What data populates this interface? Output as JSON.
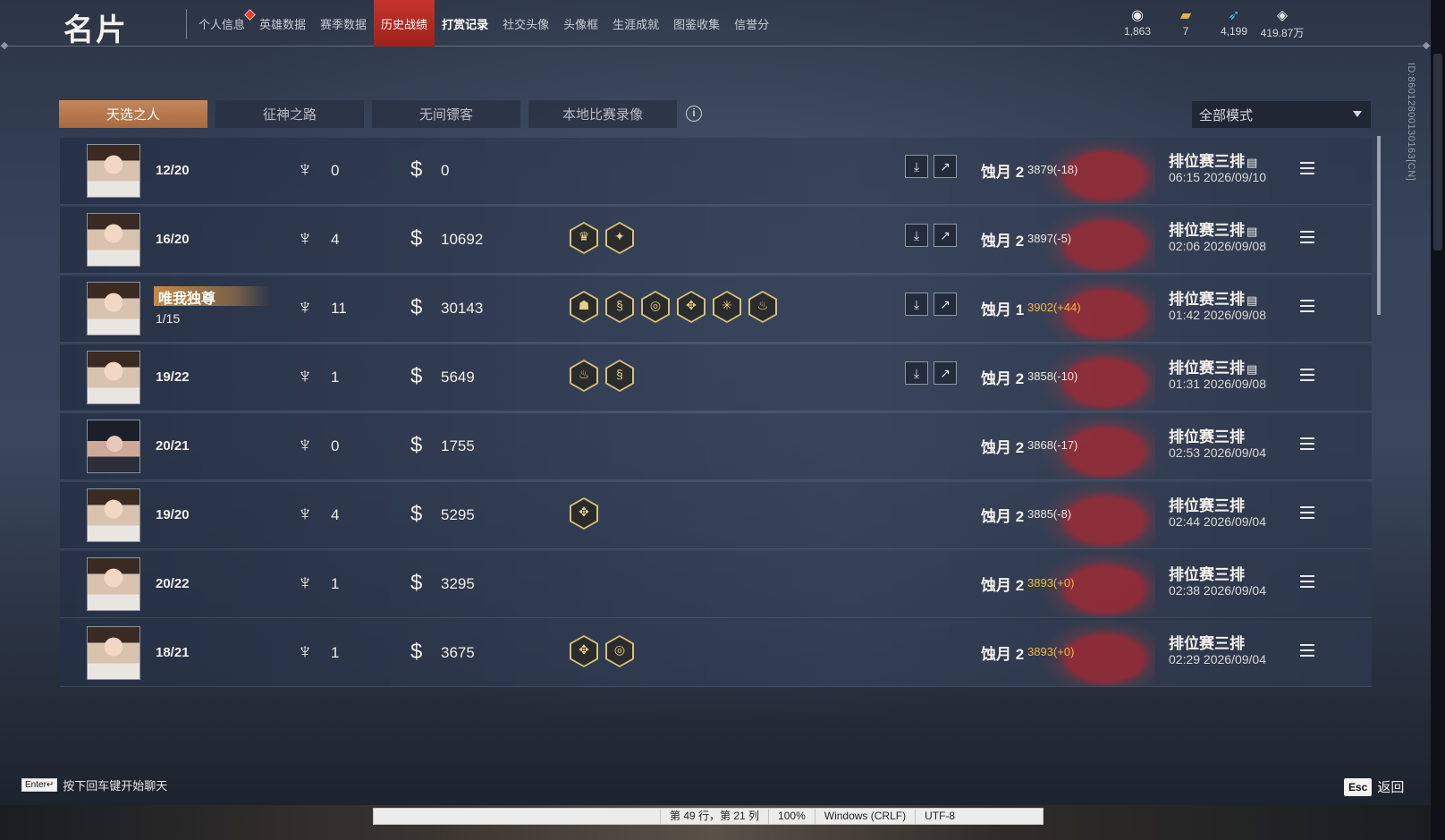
{
  "header": {
    "title": "名片",
    "nav": [
      {
        "label": "个人信息",
        "state": "notify"
      },
      {
        "label": "英雄数据",
        "state": ""
      },
      {
        "label": "赛季数据",
        "state": ""
      },
      {
        "label": "历史战绩",
        "state": "active"
      },
      {
        "label": "打赏记录",
        "state": "bright"
      },
      {
        "label": "社交头像",
        "state": ""
      },
      {
        "label": "头像框",
        "state": ""
      },
      {
        "label": "生涯成就",
        "state": ""
      },
      {
        "label": "图鉴收集",
        "state": ""
      },
      {
        "label": "信誉分",
        "state": ""
      }
    ],
    "currencies": [
      {
        "icon": "coin-icon",
        "value": "1,863"
      },
      {
        "icon": "gold-ingot-icon",
        "value": "7"
      },
      {
        "icon": "feather-icon",
        "value": "4,199"
      },
      {
        "icon": "gem-icon",
        "value": "419.87万"
      }
    ],
    "player_id": "ID:8601280013016​3[CN]"
  },
  "tabs": [
    "天选之人",
    "征神之路",
    "无间镖客",
    "本地比赛录像"
  ],
  "active_tab": 0,
  "mode_filter": {
    "value": "全部模式"
  },
  "matches": [
    {
      "honor": "",
      "kda": "12/20",
      "kills": "0",
      "money": "0",
      "badges": [],
      "replay": true,
      "tier": "蚀月 2",
      "score": "3879(-18)",
      "score_type": "neg",
      "mode": "排位赛三排",
      "has_doc": true,
      "time": "06:15  2026/09/10",
      "alt_avatar": false
    },
    {
      "honor": "",
      "kda": "16/20",
      "kills": "4",
      "money": "10692",
      "badges": [
        "crown-badge-icon",
        "wings-badge-icon"
      ],
      "replay": true,
      "tier": "蚀月 2",
      "score": "3897(-5)",
      "score_type": "neg",
      "mode": "排位赛三排",
      "has_doc": true,
      "time": "02:06  2026/09/08",
      "alt_avatar": false
    },
    {
      "honor": "唯我独尊",
      "kda": "1/15",
      "kills": "11",
      "money": "30143",
      "badges": [
        "demon-badge-icon",
        "dragon-badge-icon",
        "spiral-badge-icon",
        "blade-badge-icon",
        "star-badge-icon",
        "fire-badge-icon"
      ],
      "replay": true,
      "tier": "蚀月 1",
      "score": "3902(+44)",
      "score_type": "pos",
      "mode": "排位赛三排",
      "has_doc": true,
      "time": "01:42  2026/09/08",
      "alt_avatar": false
    },
    {
      "honor": "",
      "kda": "19/22",
      "kills": "1",
      "money": "5649",
      "badges": [
        "fire-badge-icon",
        "dragon-badge-icon"
      ],
      "replay": true,
      "tier": "蚀月 2",
      "score": "3858(-10)",
      "score_type": "neg",
      "mode": "排位赛三排",
      "has_doc": true,
      "time": "01:31  2026/09/08",
      "alt_avatar": false
    },
    {
      "honor": "",
      "kda": "20/21",
      "kills": "0",
      "money": "1755",
      "badges": [],
      "replay": false,
      "tier": "蚀月 2",
      "score": "3868(-17)",
      "score_type": "neg",
      "mode": "排位赛三排",
      "has_doc": false,
      "time": "02:53  2026/09/04",
      "alt_avatar": true
    },
    {
      "honor": "",
      "kda": "19/20",
      "kills": "4",
      "money": "5295",
      "badges": [
        "blade-badge-icon"
      ],
      "replay": false,
      "tier": "蚀月 2",
      "score": "3885(-8)",
      "score_type": "neg",
      "mode": "排位赛三排",
      "has_doc": false,
      "time": "02:44  2026/09/04",
      "alt_avatar": false
    },
    {
      "honor": "",
      "kda": "20/22",
      "kills": "1",
      "money": "3295",
      "badges": [],
      "replay": false,
      "tier": "蚀月 2",
      "score": "3893(+0)",
      "score_type": "pos",
      "mode": "排位赛三排",
      "has_doc": false,
      "time": "02:38  2026/09/04",
      "alt_avatar": false
    },
    {
      "honor": "",
      "kda": "18/21",
      "kills": "1",
      "money": "3675",
      "badges": [
        "blade-badge-icon",
        "spiral-badge-icon"
      ],
      "replay": false,
      "tier": "蚀月 2",
      "score": "3893(+0)",
      "score_type": "pos",
      "mode": "排位赛三排",
      "has_doc": false,
      "time": "02:29  2026/09/04",
      "alt_avatar": false
    }
  ],
  "footer": {
    "enter_key": "Enter↵",
    "enter_hint": "按下回车键开始聊天",
    "esc_key": "Esc",
    "esc_label": "返回"
  },
  "editor_status": {
    "position": "第 49 行，第 21 列",
    "zoom": "100%",
    "line_ending": "Windows (CRLF)",
    "encoding": "UTF-8"
  },
  "colors": {
    "accent_tab": "#b87a4c",
    "active_nav": "#b52a24",
    "score_positive": "#f2b547"
  }
}
